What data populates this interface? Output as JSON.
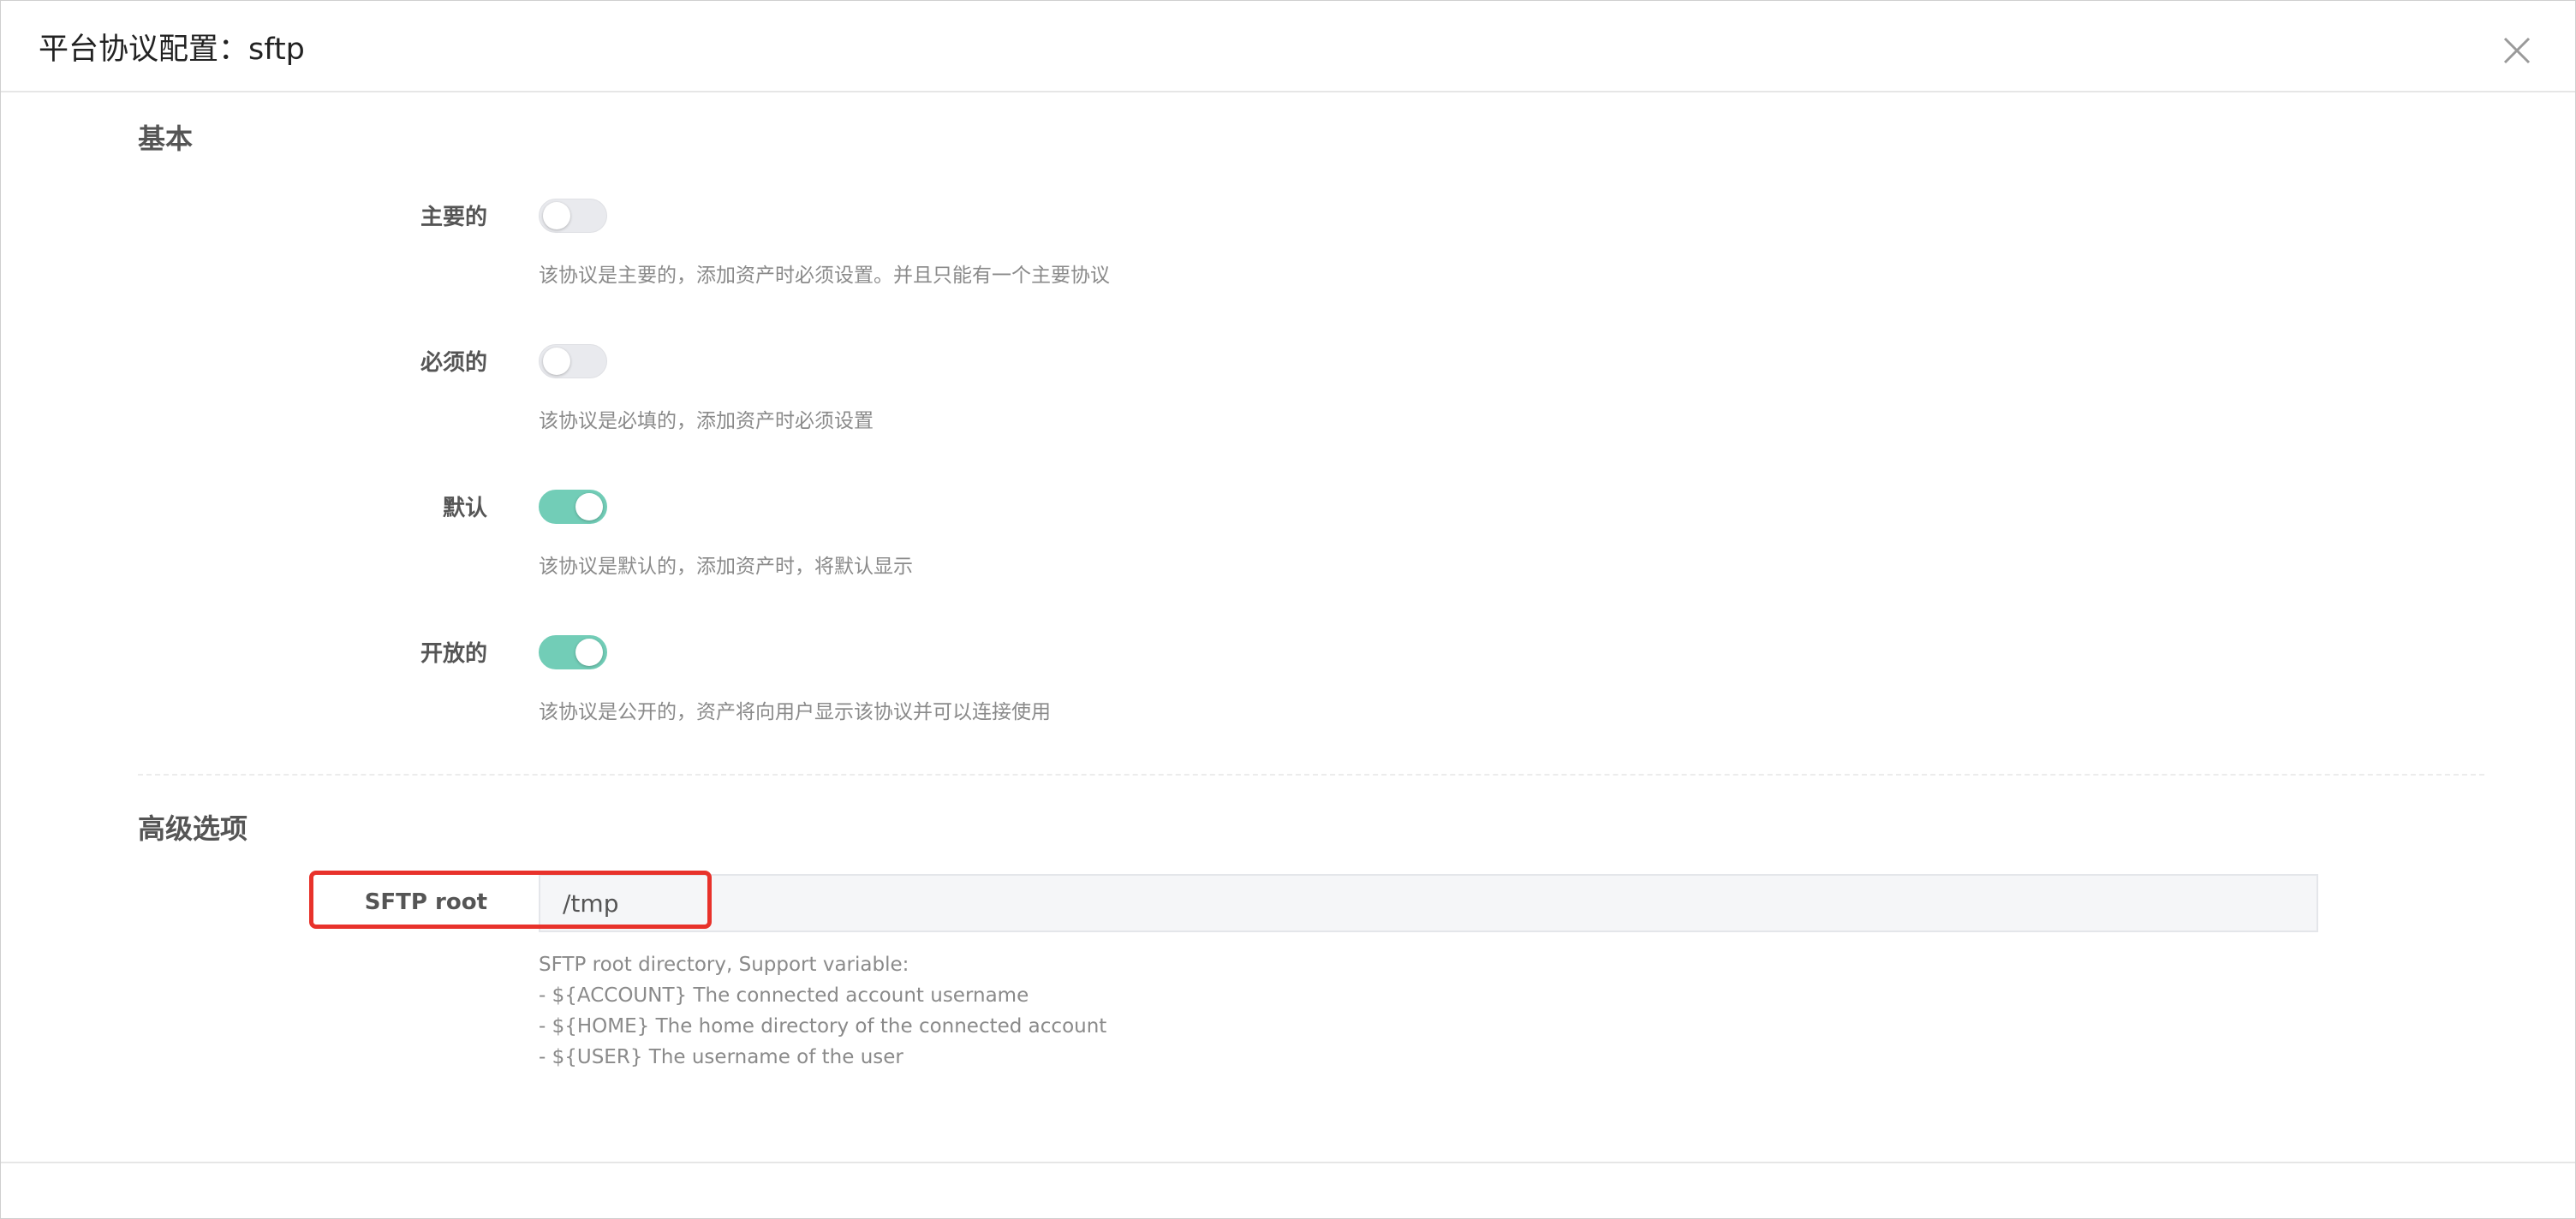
{
  "dialog": {
    "title": "平台协议配置：sftp",
    "close_icon": "close-icon"
  },
  "basic": {
    "section_title": "基本",
    "fields": [
      {
        "label": "主要的",
        "enabled": false,
        "help": "该协议是主要的，添加资产时必须设置。并且只能有一个主要协议"
      },
      {
        "label": "必须的",
        "enabled": false,
        "help": "该协议是必填的，添加资产时必须设置"
      },
      {
        "label": "默认",
        "enabled": true,
        "help": "该协议是默认的，添加资产时，将默认显示"
      },
      {
        "label": "开放的",
        "enabled": true,
        "help": "该协议是公开的，资产将向用户显示该协议并可以连接使用"
      }
    ]
  },
  "advanced": {
    "section_title": "高级选项",
    "sftp_root": {
      "label": "SFTP root",
      "value": "/tmp",
      "help_lines": [
        "SFTP root directory, Support variable:",
        "- ${ACCOUNT} The connected account username",
        "- ${HOME} The home directory of the connected account",
        "- ${USER} The username of the user"
      ]
    }
  },
  "colors": {
    "toggle_on": "#72cdb7",
    "toggle_off": "#e9eaee",
    "highlight": "#e8322b"
  }
}
